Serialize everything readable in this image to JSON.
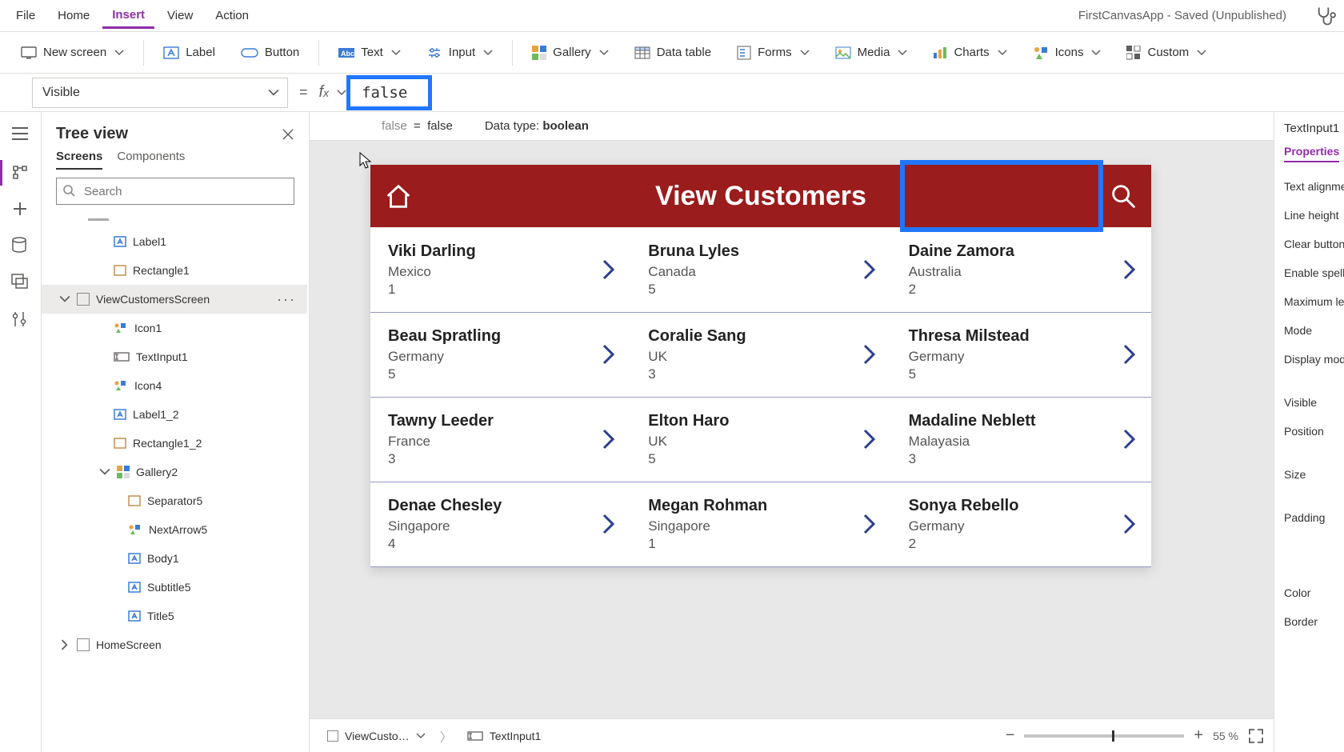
{
  "topmenu": {
    "file": "File",
    "home": "Home",
    "insert": "Insert",
    "view": "View",
    "action": "Action"
  },
  "app_status": "FirstCanvasApp - Saved (Unpublished)",
  "ribbon": {
    "new_screen": "New screen",
    "label": "Label",
    "button": "Button",
    "text": "Text",
    "input": "Input",
    "gallery": "Gallery",
    "data_table": "Data table",
    "forms": "Forms",
    "media": "Media",
    "charts": "Charts",
    "icons": "Icons",
    "custom": "Custom"
  },
  "formula": {
    "property": "Visible",
    "value": "false",
    "eval_lhs": "false",
    "eval_rhs": "false",
    "datatype_label": "Data type:",
    "datatype_value": "boolean"
  },
  "treeview": {
    "title": "Tree view",
    "tab_screens": "Screens",
    "tab_components": "Components",
    "search_placeholder": "Search",
    "items": {
      "label1": "Label1",
      "rectangle1": "Rectangle1",
      "viewcust": "ViewCustomersScreen",
      "icon1": "Icon1",
      "textinput1": "TextInput1",
      "icon4": "Icon4",
      "label1_2": "Label1_2",
      "rectangle1_2": "Rectangle1_2",
      "gallery2": "Gallery2",
      "separator5": "Separator5",
      "nextarrow5": "NextArrow5",
      "body1": "Body1",
      "subtitle5": "Subtitle5",
      "title5": "Title5",
      "homescreen": "HomeScreen"
    }
  },
  "preview": {
    "header_title": "View Customers",
    "customers": [
      {
        "name": "Viki Darling",
        "country": "Mexico",
        "num": "1"
      },
      {
        "name": "Bruna Lyles",
        "country": "Canada",
        "num": "5"
      },
      {
        "name": "Daine Zamora",
        "country": "Australia",
        "num": "2"
      },
      {
        "name": "Beau Spratling",
        "country": "Germany",
        "num": "5"
      },
      {
        "name": "Coralie Sang",
        "country": "UK",
        "num": "3"
      },
      {
        "name": "Thresa Milstead",
        "country": "Germany",
        "num": "5"
      },
      {
        "name": "Tawny Leeder",
        "country": "France",
        "num": "3"
      },
      {
        "name": "Elton Haro",
        "country": "UK",
        "num": "5"
      },
      {
        "name": "Madaline Neblett",
        "country": "Malayasia",
        "num": "3"
      },
      {
        "name": "Denae Chesley",
        "country": "Singapore",
        "num": "4"
      },
      {
        "name": "Megan Rohman",
        "country": "Singapore",
        "num": "1"
      },
      {
        "name": "Sonya Rebello",
        "country": "Germany",
        "num": "2"
      }
    ]
  },
  "footer": {
    "crumb1": "ViewCusto…",
    "crumb2": "TextInput1",
    "zoom_value": "55",
    "zoom_pct": "%"
  },
  "rightpanel": {
    "title": "TextInput1",
    "tab": "Properties",
    "rows": {
      "r1": "Text alignme",
      "r2": "Line height",
      "r3": "Clear button",
      "r4": "Enable spell",
      "r5": "Maximum le",
      "r6": "Mode",
      "r7": "Display mod",
      "r8": "Visible",
      "r9": "Position",
      "r10": "Size",
      "r11": "Padding",
      "r12": "Color",
      "r13": "Border"
    }
  }
}
